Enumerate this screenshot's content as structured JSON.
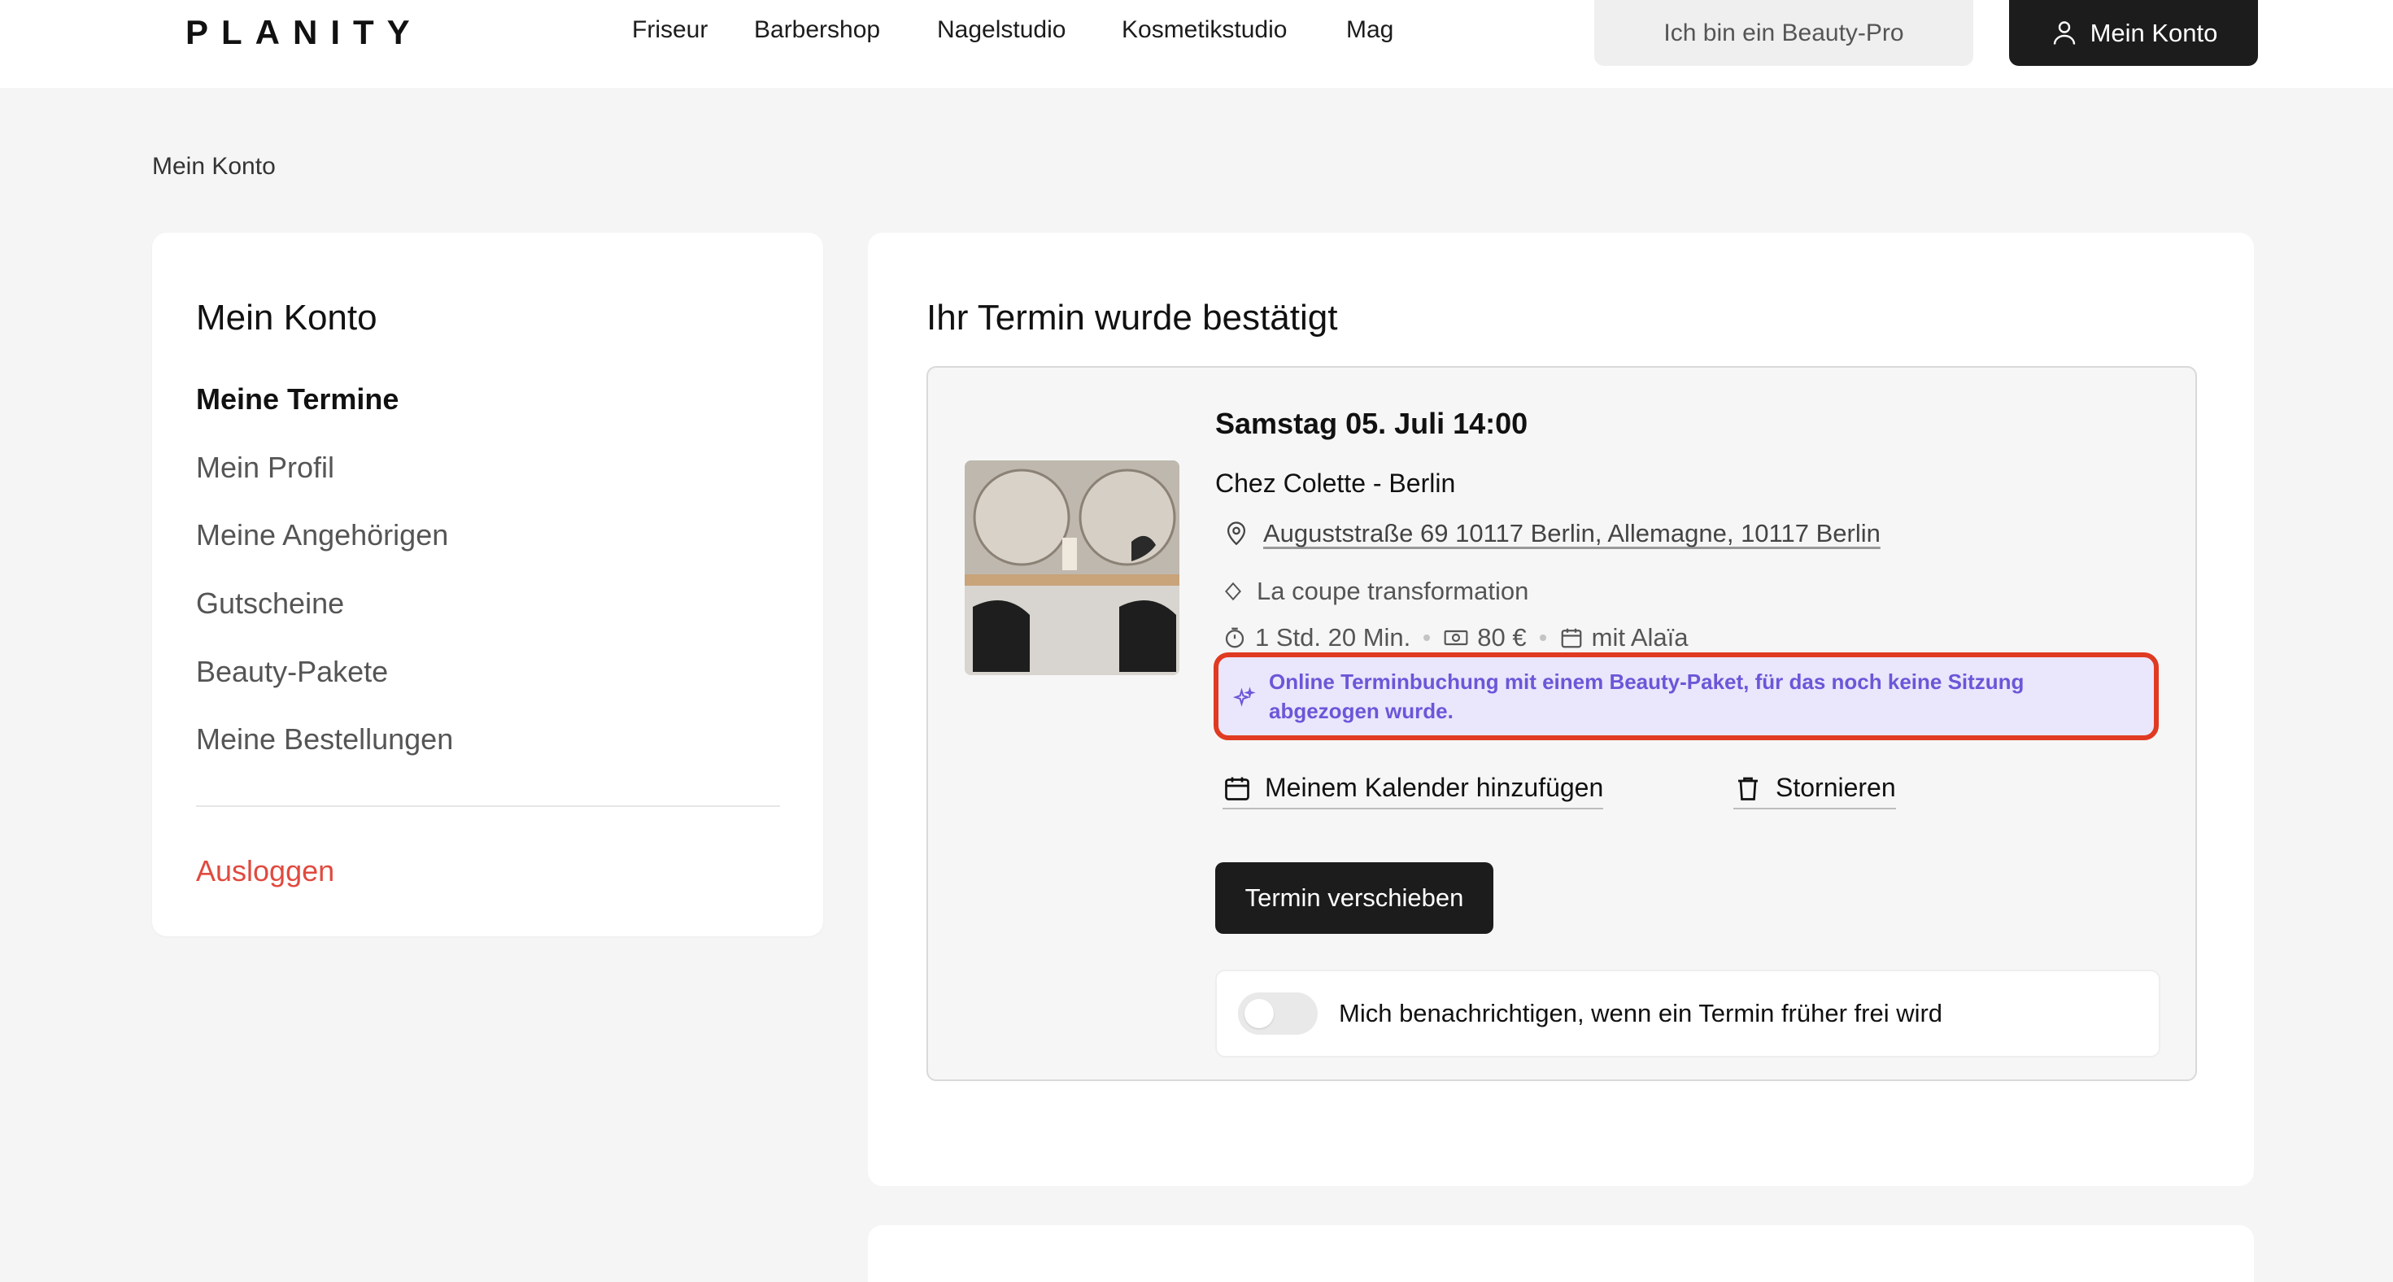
{
  "header": {
    "logo": "PLANITY",
    "nav": [
      "Friseur",
      "Barbershop",
      "Nagelstudio",
      "Kosmetikstudio",
      "Mag"
    ],
    "pro_button": "Ich bin ein Beauty-Pro",
    "account_button": "Mein Konto"
  },
  "breadcrumb": "Mein Konto",
  "sidebar": {
    "title": "Mein Konto",
    "items": [
      "Meine Termine",
      "Mein Profil",
      "Meine Angehörigen",
      "Gutscheine",
      "Beauty-Pakete",
      "Meine Bestellungen"
    ],
    "logout": "Ausloggen"
  },
  "main": {
    "title": "Ihr Termin wurde bestätigt",
    "appointment": {
      "datetime": "Samstag 05. Juli 14:00",
      "salon": "Chez Colette - Berlin",
      "address": "Auguststraße 69 10117 Berlin, Allemagne, 10117 Berlin",
      "service": "La coupe transformation",
      "duration": "1 Std. 20 Min.",
      "price": "80 €",
      "staff": "mit Alaïa",
      "package_notice": "Online Terminbuchung mit einem Beauty-Paket, für das noch keine Sitzung abgezogen wurde.",
      "add_calendar": "Meinem Kalender hinzufügen",
      "cancel": "Stornieren",
      "reschedule": "Termin verschieben",
      "notify_label": "Mich benachrichtigen, wenn ein Termin früher frei wird"
    }
  },
  "colors": {
    "accent_dark": "#1c1c1c",
    "logout_red": "#e04a3f",
    "package_purple": "#6a57d8",
    "highlight_red": "#e03a22"
  }
}
